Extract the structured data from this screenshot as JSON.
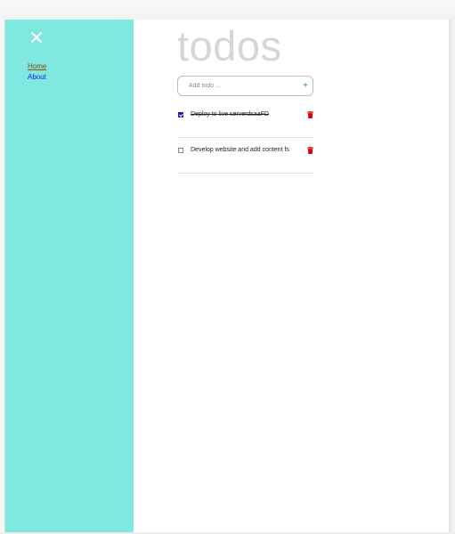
{
  "app": {
    "title": "todos"
  },
  "sidebar": {
    "background": "#7fe8e0",
    "close_icon": "close-icon",
    "links": [
      {
        "label": "Home",
        "color": "#8b4a07"
      },
      {
        "label": "About",
        "color": "#1a1aee"
      }
    ]
  },
  "add_todo": {
    "placeholder": "Add todo ...",
    "value": "",
    "add_icon": "plus-icon",
    "add_symbol": "+"
  },
  "todos": [
    {
      "text": "Deploy to live serverdsaaFD",
      "completed": true,
      "delete_icon": "trash-icon"
    },
    {
      "text": "Develop website and add content fs",
      "completed": false,
      "delete_icon": "trash-icon"
    }
  ],
  "colors": {
    "accent_delete": "#e00000",
    "add_symbol": "#2aa52a"
  }
}
